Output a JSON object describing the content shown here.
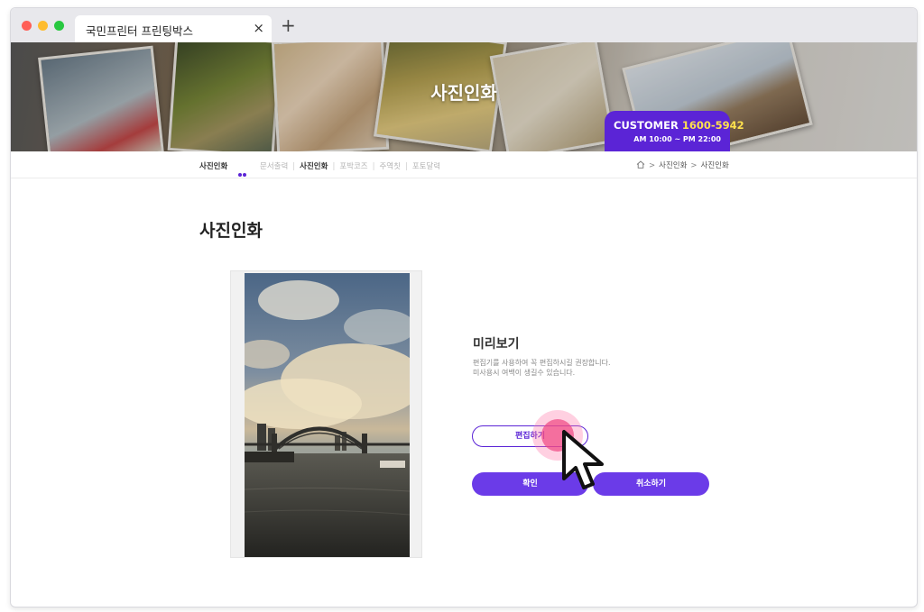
{
  "browser": {
    "tab_title": "국민프린터 프린팅박스",
    "tab_close": "×",
    "new_tab": "+"
  },
  "hero": {
    "title": "사진인화",
    "customer": {
      "label": "CUSTOMER",
      "phone": "1600-5942",
      "hours": "AM 10:00 ~ PM 22:00"
    },
    "colors": {
      "accent": "#5b24d6",
      "phone": "#ffe14d"
    }
  },
  "subnav": {
    "current": "사진인화",
    "items": [
      {
        "label": "문서출력",
        "active": false
      },
      {
        "label": "사진인화",
        "active": true
      },
      {
        "label": "포박코즈",
        "active": false
      },
      {
        "label": "주역칫",
        "active": false
      },
      {
        "label": "포토달력",
        "active": false
      }
    ],
    "separator": "|"
  },
  "breadcrumb": {
    "home_icon": "home-icon",
    "separator": ">",
    "items": [
      "사진인화",
      "사진인화"
    ]
  },
  "page": {
    "title": "사진인화"
  },
  "preview": {
    "heading": "미리보기",
    "desc_line1": "편집기를 사용하여 꼭 편집하시길 권장합니다.",
    "desc_line2": "미사용시 여백이 생길수 있습니다.",
    "image_subject": "harbour-bridge-photo"
  },
  "buttons": {
    "edit": "편집하기",
    "ok": "확인",
    "cancel": "취소하기"
  },
  "colors": {
    "primary": "#6b3be8",
    "outline": "#5b24d6",
    "click_highlight": "#f04682"
  }
}
